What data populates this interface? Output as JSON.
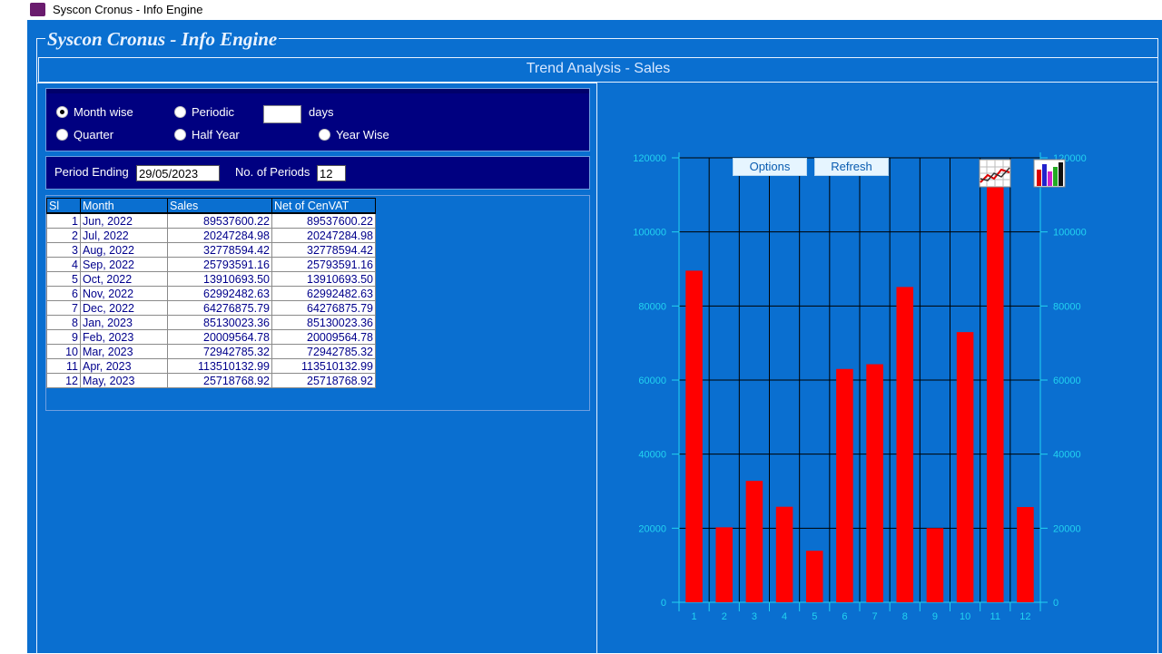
{
  "window": {
    "title": "Syscon Cronus - Info Engine"
  },
  "header": {
    "brand": "Syscon Cronus - Info Engine",
    "subtitle": "Trend Analysis - Sales"
  },
  "options": {
    "month_wise": "Month wise",
    "periodic": "Periodic",
    "days_value": "",
    "days_label": "days",
    "quarter": "Quarter",
    "half_year": "Half Year",
    "year_wise": "Year Wise",
    "selected": "month_wise"
  },
  "period": {
    "ending_label": "Period Ending",
    "ending_value": "29/05/2023",
    "count_label": "No. of Periods",
    "count_value": "12"
  },
  "table": {
    "headers": [
      "Sl",
      "Month",
      "Sales",
      "Net of CenVAT"
    ],
    "rows": [
      [
        "1",
        "Jun, 2022",
        "89537600.22",
        "89537600.22"
      ],
      [
        "2",
        "Jul, 2022",
        "20247284.98",
        "20247284.98"
      ],
      [
        "3",
        "Aug, 2022",
        "32778594.42",
        "32778594.42"
      ],
      [
        "4",
        "Sep, 2022",
        "25793591.16",
        "25793591.16"
      ],
      [
        "5",
        "Oct, 2022",
        "13910693.50",
        "13910693.50"
      ],
      [
        "6",
        "Nov, 2022",
        "62992482.63",
        "62992482.63"
      ],
      [
        "7",
        "Dec, 2022",
        "64276875.79",
        "64276875.79"
      ],
      [
        "8",
        "Jan, 2023",
        "85130023.36",
        "85130023.36"
      ],
      [
        "9",
        "Feb, 2023",
        "20009564.78",
        "20009564.78"
      ],
      [
        "10",
        "Mar, 2023",
        "72942785.32",
        "72942785.32"
      ],
      [
        "11",
        "Apr, 2023",
        "113510132.99",
        "113510132.99"
      ],
      [
        "12",
        "May, 2023",
        "25718768.92",
        "25718768.92"
      ]
    ]
  },
  "toolbar": {
    "options_label": "Options",
    "refresh_label": "Refresh",
    "line_chart_icon": "line-chart-icon",
    "bar_chart_icon": "bar-chart-icon"
  },
  "colors": {
    "background": "#0a6fd0",
    "panel": "#000080",
    "bar": "#ff0000",
    "axis_text": "#22d3f0"
  },
  "chart_data": {
    "type": "bar",
    "categories": [
      "1",
      "2",
      "3",
      "4",
      "5",
      "6",
      "7",
      "8",
      "9",
      "10",
      "11",
      "12"
    ],
    "values": [
      89537.6,
      20247.28,
      32778.59,
      25793.59,
      13910.69,
      62992.48,
      64276.88,
      85130.02,
      20009.56,
      72942.79,
      113510.13,
      25718.77
    ],
    "ylim": [
      0,
      120000
    ],
    "yticks": [
      "0",
      "20000",
      "40000",
      "60000",
      "80000",
      "100000",
      "120000"
    ],
    "grid": true,
    "title": "",
    "xlabel": "",
    "ylabel": ""
  }
}
